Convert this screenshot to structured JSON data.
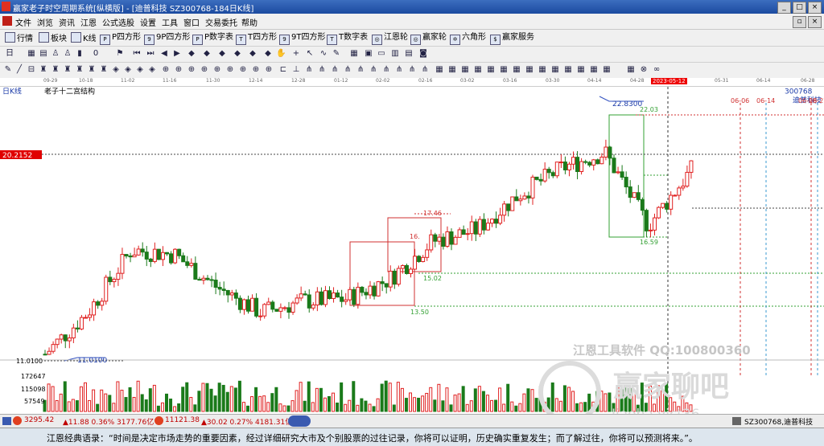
{
  "window": {
    "title": "赢家老子时空周期系统[纵横版] - [迪普科技  SZ300768-184日K线]"
  },
  "menu": [
    "文件",
    "浏览",
    "资讯",
    "江恩",
    "公式选股",
    "设置",
    "工具",
    "窗口",
    "交易委托",
    "帮助"
  ],
  "toolbar1": [
    "行情",
    "板块",
    "K线",
    "P四方形",
    "9P四方形",
    "P数字表",
    "T四方形",
    "9T四方形",
    "T数字表",
    "江恩轮",
    "赢家轮",
    "六角形",
    "赢家服务"
  ],
  "chart": {
    "period_label": "日K线",
    "indicator_title": "老子十二宫结构",
    "stock_code": "300768",
    "stock_name": "迪普科技",
    "current_date": "2023-05-12",
    "date_ticks": [
      "09-29",
      "10-18",
      "11-02",
      "11-16",
      "11-30",
      "12-14",
      "12-28",
      "01-12",
      "02-02",
      "02-16",
      "03-02",
      "03-16",
      "03-30",
      "04-14",
      "04-28",
      "05-31",
      "06-14",
      "06-28"
    ],
    "price_left_label": "20.2152",
    "low_axis_label": "11.0100",
    "price_labels": {
      "high": "22.8300",
      "p22": "22.03",
      "p1746": "17.46",
      "p16": "16.",
      "p1502": "15.02",
      "p1350": "13.50",
      "p1659": "16.59",
      "low": "11.0100"
    },
    "future_dates": [
      "06-06",
      "06-14",
      "06-28",
      "06-27"
    ],
    "volume_axis": [
      "172647",
      "115098",
      "57549"
    ],
    "watermark": [
      "江恩工具软件  QQ:100800360",
      "赢家聊吧",
      "Jiaoba.vict36"
    ]
  },
  "chart_data": {
    "type": "candlestick",
    "stock": "迪普科技 SZ300768",
    "period": "日K线",
    "ylim": [
      11.01,
      22.83
    ],
    "marked_prices": [
      22.83,
      22.03,
      20.2152,
      17.46,
      15.02,
      13.5,
      16.59,
      11.01
    ],
    "x": [
      "09-29",
      "10-18",
      "11-02",
      "11-16",
      "11-30",
      "12-14",
      "12-28",
      "01-12",
      "02-02",
      "02-16",
      "03-02",
      "03-16",
      "03-30",
      "04-14",
      "04-28",
      "05-12"
    ],
    "close": [
      11.2,
      13.1,
      15.9,
      15.7,
      14.2,
      13.1,
      13.6,
      13.7,
      14.6,
      16.3,
      16.8,
      18.4,
      19.6,
      20.3,
      17.0,
      19.5
    ],
    "volume_axis_ticks": [
      57549,
      115098,
      172647
    ]
  },
  "status": {
    "sh": "3295.42",
    "sh_chg": "▲11.88 0.36% 3177.76亿",
    "sz": "11121.38",
    "sz_chg": "▲30.02 0.27% 4181.31亿",
    "right": "SZ300768,迪普科技"
  },
  "quote": "江恩经典语录：“时间是决定市场走势的重要因素，经过详细研究大市及个别股票的过往记录，你将可以证明，历史确实重复发生；而了解过往，你将可以预测将来。”。"
}
